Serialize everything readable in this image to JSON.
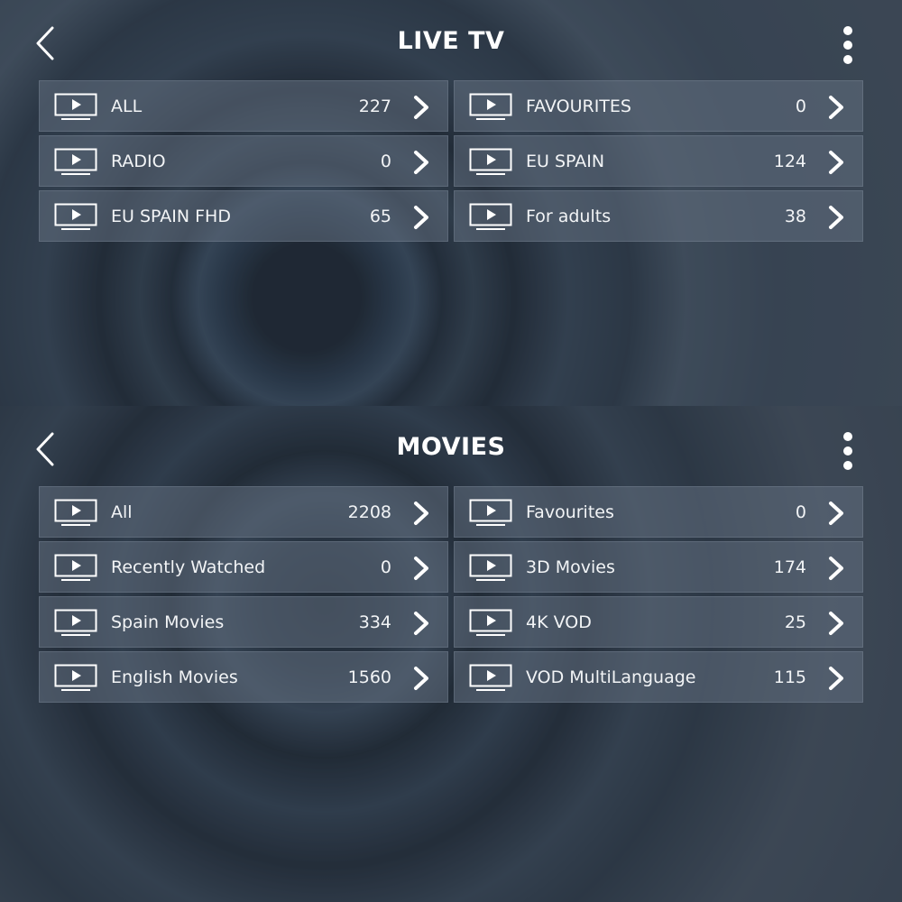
{
  "live_tv": {
    "title": "LIVE TV",
    "items": [
      {
        "label": "ALL",
        "count": "227"
      },
      {
        "label": "FAVOURITES",
        "count": "0"
      },
      {
        "label": "RADIO",
        "count": "0"
      },
      {
        "label": "EU SPAIN",
        "count": "124"
      },
      {
        "label": "EU SPAIN FHD",
        "count": "65"
      },
      {
        "label": "For adults",
        "count": "38"
      }
    ]
  },
  "movies": {
    "title": "MOVIES",
    "items": [
      {
        "label": "All",
        "count": "2208"
      },
      {
        "label": "Favourites",
        "count": "0"
      },
      {
        "label": "Recently Watched",
        "count": "0"
      },
      {
        "label": "3D Movies",
        "count": "174"
      },
      {
        "label": "Spain Movies",
        "count": "334"
      },
      {
        "label": "4K VOD",
        "count": "25"
      },
      {
        "label": "English Movies",
        "count": "1560"
      },
      {
        "label": "VOD MultiLanguage",
        "count": "115"
      }
    ]
  },
  "icons": {
    "back": "back-chevron-icon",
    "menu": "more-vertical-icon",
    "row": "tv-play-icon",
    "row_arrow": "chevron-right-icon"
  },
  "colors": {
    "text": "#ffffff",
    "row_background": "#627080"
  }
}
